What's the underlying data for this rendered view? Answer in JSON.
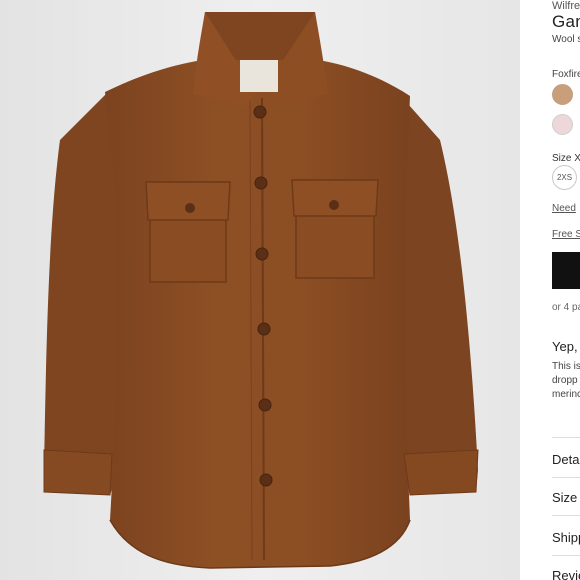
{
  "product": {
    "brand": "Wilfre",
    "name": "Gan",
    "subtitle": "Wool s",
    "image_alt": "Brown wool button-up shirt jacket with two chest flap pockets"
  },
  "color": {
    "label": "Foxfire",
    "swatches": [
      {
        "name": "tan-swatch",
        "color": "#c89f7a"
      },
      {
        "name": "pink-swatch",
        "color": "#edd7d8"
      }
    ]
  },
  "size": {
    "label": "Size X",
    "options": [
      "2XS"
    ],
    "need_link": "Need",
    "free_link": "Free S"
  },
  "purchase": {
    "payments": "or 4 pa"
  },
  "description": {
    "heading": "Yep,",
    "lines": [
      "This is",
      "dropp",
      "merinc"
    ]
  },
  "accordions": [
    "Deta",
    "Size",
    "Shipp",
    "Revie"
  ],
  "colors": {
    "coat": "#8a4c22",
    "background": "#ececec",
    "button_black": "#111111"
  }
}
